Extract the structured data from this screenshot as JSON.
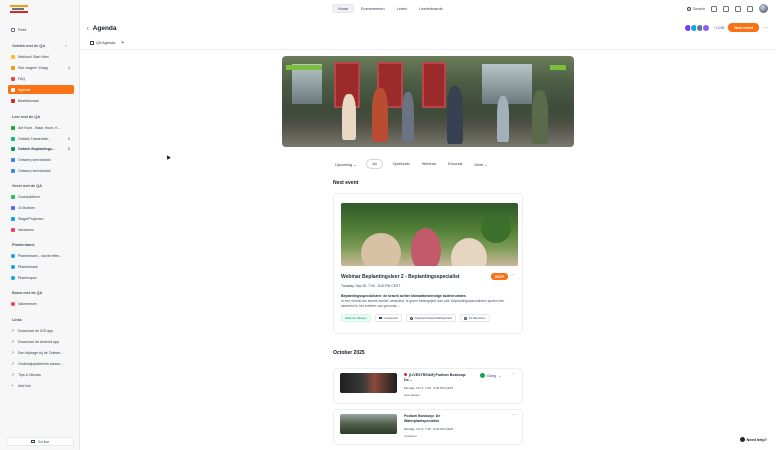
{
  "topnav": {
    "items": [
      {
        "label": "Home"
      },
      {
        "label": "Evenementen"
      },
      {
        "label": "Leden"
      },
      {
        "label": "Leaderboards"
      }
    ],
    "search_label": "Search"
  },
  "sidebar": {
    "feed_label": "Feed",
    "group1": {
      "title": "Ontdek met de QA",
      "items": [
        {
          "label": "Welkom! Start Hier!",
          "count": ""
        },
        {
          "label": "Stel vragen! Vraag",
          "count": "4"
        },
        {
          "label": "FAQ",
          "count": ""
        },
        {
          "label": "Agenda",
          "count": ""
        },
        {
          "label": "Bestelkanaal",
          "count": ""
        }
      ]
    },
    "group2": {
      "title": "Leer met de QA",
      "items": [
        {
          "label": "Ant Kant - Waar, Ihure, K...",
          "count": ""
        },
        {
          "label": "Ontdek Tuinarchite...",
          "count": "5"
        },
        {
          "label": "Ontdek Beplantings...",
          "count": "2"
        },
        {
          "label": "Ontwerp kennisbank",
          "count": ""
        },
        {
          "label": "Ontwerp kennisbank",
          "count": ""
        }
      ]
    },
    "group3": {
      "title": "Groei met de QA",
      "items": [
        {
          "label": "Groeiplatform",
          "count": ""
        },
        {
          "label": "10 Boeken",
          "count": ""
        },
        {
          "label": "Stage/Projecten",
          "count": ""
        },
        {
          "label": "Vacatures",
          "count": ""
        }
      ]
    },
    "group4": {
      "title": "Plantenbank",
      "items": [
        {
          "label": "Plantenbank - stovie effec...",
          "count": ""
        },
        {
          "label": "Plantenbank",
          "count": ""
        },
        {
          "label": "Plantenquiz",
          "count": ""
        }
      ]
    },
    "group5": {
      "title": "Bouw met de QA",
      "items": [
        {
          "label": "Vakmensen",
          "count": ""
        }
      ]
    },
    "group6": {
      "title": "Links",
      "items": [
        {
          "label": "Download de iOS app",
          "count": ""
        },
        {
          "label": "Download de Android app",
          "count": ""
        },
        {
          "label": "Een bijdrage bij de Ontwer...",
          "count": ""
        },
        {
          "label": "Onderwijsplatforms wesse...",
          "count": ""
        },
        {
          "label": "Tips & Nieuws",
          "count": ""
        },
        {
          "label": "Add link",
          "count": ""
        }
      ]
    },
    "bottom_label": "Go live"
  },
  "header": {
    "title": "Agenda",
    "subtab": "QA Agenda",
    "add": "+",
    "members_count": "+2,036",
    "new_event_label": "New event",
    "more": "···"
  },
  "filters": {
    "upcoming": "Upcoming",
    "all": "All",
    "opleiding": "Opleiholer",
    "webinar": "Webinar",
    "excursie": "Excursie",
    "more": "More"
  },
  "next_event": {
    "section_title": "Next event",
    "title": "Webinar Beplantingsleer 2 - Beplantingsspecialist",
    "date": "Tuesday, Sep 30, 7:00 - 8:00 PM CEST",
    "desc_bold": "Beplantingsspecialisten: de kracht achter klimaatbestendige buitenruimtes",
    "desc": "In een wereld die steeds sneller verandert, is groen belangrijker dan ooit. Beplantingsspecialisten spelen een sleutelrol in het creëren van gezonde,...",
    "badge": "RSVP",
    "chips": [
      "Webinar Allsaan",
      "Livestream",
      "Dapper/Onbeschikbaarheid",
      "10 Members"
    ]
  },
  "october": {
    "section_title": "October 2025",
    "items": [
      {
        "title": "[LIVESTREAM] Podium Boskoop: De...",
        "date": "Monday, Oct 6, 7:30 - 9:30 PM CEST",
        "location": "Live stream",
        "going": "Going"
      },
      {
        "title": "Podium Boskoop: De Waterplantspecialist",
        "date": "Monday, Oct 6, 7:30 - 9:30 PM CEST",
        "location": "In person",
        "going": ""
      }
    ]
  },
  "help_label": "Need help?"
}
